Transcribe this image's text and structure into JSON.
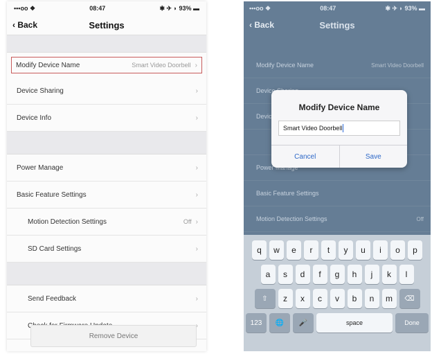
{
  "left": {
    "status": {
      "carrier": "•••oo ❖",
      "time": "08:47",
      "battery": "✱ ✈ ◗ 93% ▬"
    },
    "nav": {
      "back": "‹ Back",
      "title": "Settings"
    },
    "rows_group1": [
      {
        "label": "Modify Device Name",
        "value": "Smart Video Doorbell"
      },
      {
        "label": "Device Sharing"
      },
      {
        "label": "Device Info"
      }
    ],
    "rows_group2": [
      {
        "label": "Power Manage"
      },
      {
        "label": "Basic Feature Settings"
      },
      {
        "label": "Motion Detection Settings",
        "value": "Off"
      },
      {
        "label": "SD Card Settings"
      }
    ],
    "rows_group3": [
      {
        "label": "Send Feedback"
      },
      {
        "label": "Check for Firmware Update"
      }
    ],
    "remove_button": "Remove Device"
  },
  "right": {
    "status": {
      "carrier": "•••oo ❖",
      "time": "08:47",
      "battery": "✱ ✈ ◗ 93% ▬"
    },
    "nav": {
      "back": "‹ Back",
      "title": "Settings"
    },
    "bg_rows": [
      {
        "label": "Modify Device Name",
        "value": "Smart Video Doorbell"
      },
      {
        "label": "Device Sharing"
      },
      {
        "label": "Device Info"
      },
      {
        "label": ""
      },
      {
        "label": "Power Manage"
      },
      {
        "label": "Basic Feature Settings"
      },
      {
        "label": "Motion Detection Settings",
        "value": "Off"
      }
    ],
    "dialog": {
      "title": "Modify Device Name",
      "input_value": "Smart Video Doorbell",
      "cancel": "Cancel",
      "save": "Save"
    },
    "keyboard": {
      "row1": [
        "q",
        "w",
        "e",
        "r",
        "t",
        "y",
        "u",
        "i",
        "o",
        "p"
      ],
      "row2": [
        "a",
        "s",
        "d",
        "f",
        "g",
        "h",
        "j",
        "k",
        "l"
      ],
      "row3": [
        "z",
        "x",
        "c",
        "v",
        "b",
        "n",
        "m"
      ],
      "shift": "⇧",
      "delete": "⌫",
      "numbers": "123",
      "globe": "🌐",
      "mic": "🎤",
      "space": "space",
      "done": "Done"
    }
  }
}
